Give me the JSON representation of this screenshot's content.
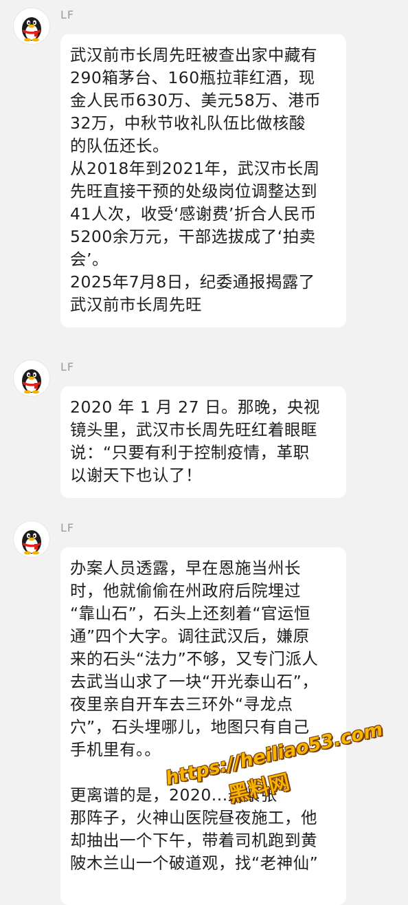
{
  "messages": [
    {
      "sender": "LF",
      "avatar_icon": "qq-penguin-icon",
      "paragraphs": [
        {
          "lines": [
            "武汉前市长周先旺被查出家中藏有",
            "290箱茅台、160瓶拉菲红酒，现",
            "金人民币630万、美元58万、港币",
            "32万，中秋节收礼队伍比做核酸",
            "的队伍还长。"
          ]
        },
        {
          "lines": [
            "从2018年到2021年，武汉市长周",
            "先旺直接干预的处级岗位调整达到",
            "41人次，收受‘感谢费’折合人民币",
            "5200余万元，干部选拔成了‘拍卖",
            "会’。"
          ]
        },
        {
          "lines": [
            "2025年7月8日，纪委通报揭露了",
            "武汉前市长周先旺"
          ]
        }
      ]
    },
    {
      "sender": "LF",
      "avatar_icon": "qq-penguin-icon",
      "paragraphs": [
        {
          "lines": [
            "2020 年 1 月 27 日。那晚，央视",
            "镜头里，武汉市长周先旺红着眼眶",
            "说：“只要有利于控制疫情，革职",
            "以谢天下也认了！"
          ]
        }
      ]
    },
    {
      "sender": "LF",
      "avatar_icon": "qq-penguin-icon",
      "paragraphs": [
        {
          "lines": [
            "办案人员透露，早在恩施当州长",
            "时，他就偷偷在州政府后院埋过",
            "“靠山石”，石头上还刻着“官运恒",
            "通”四个大字。调往武汉后，嫌原",
            "来的石头“法力”不够，又专门派人",
            "去武当山求了一块“开光泰山石”，",
            "夜里亲自开车去三环外“寻龙点",
            "穴”，石头埋哪儿，地图只有自己",
            "手机里有。。"
          ]
        },
        {
          "lines": [
            "更离谱的是，2020...最紧张",
            "那阵子，火神山医院昼夜施工，他",
            "却抽出一个下午，带着司机跑到黄",
            "陂木兰山一个破道观，找“老神仙”"
          ]
        }
      ]
    }
  ],
  "watermark": {
    "url": "https://heiliao53.com",
    "name": "黑料网"
  },
  "colors": {
    "background": "#f2f2f2",
    "bubble": "#ffffff",
    "text": "#1e1e1e",
    "sender": "#9a9a9a",
    "watermark": "#f6b500"
  }
}
